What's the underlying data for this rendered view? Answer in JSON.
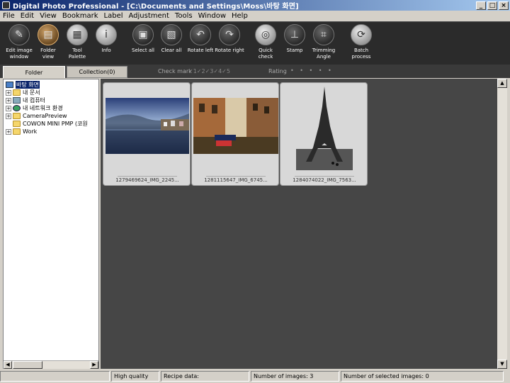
{
  "window": {
    "title": "Digital Photo Professional - [C:\\Documents and Settings\\Moss\\바탕 화면]",
    "minimize": "_",
    "maximize": "□",
    "close": "×"
  },
  "menu": [
    "File",
    "Edit",
    "View",
    "Bookmark",
    "Label",
    "Adjustment",
    "Tools",
    "Window",
    "Help"
  ],
  "toolbar": {
    "edit_image_window": "Edit image\nwindow",
    "folder_view": "Folder\nview",
    "tool_palette": "Tool\nPalette",
    "info": "Info",
    "select_all": "Select all",
    "clear_all": "Clear all",
    "rotate_left": "Rotate left",
    "rotate_right": "Rotate right",
    "quick_check": "Quick\ncheck",
    "stamp": "Stamp",
    "trimming_angle": "Trimming\nAngle",
    "batch_process": "Batch\nprocess"
  },
  "tabs": {
    "folder": "Folder",
    "collection": "Collection(0)"
  },
  "filters": {
    "check_mark_label": "Check mark",
    "check_marks": "✓1✓2✓3✓4✓5",
    "rating_label": "Rating",
    "rating_dots": "• • • • •"
  },
  "tree": {
    "desktop": "바탕 화면",
    "my_documents": "내 문서",
    "my_computer": "내 컴퓨터",
    "my_network": "내 네트워크 환경",
    "camera_preview": "CameraPreview",
    "cowon": "COWON MINI PMP (코원",
    "work": "Work"
  },
  "thumbnails": [
    {
      "caption": "1279469624_IMG_2245..."
    },
    {
      "caption": "1281115647_IMG_6745..."
    },
    {
      "caption": "1284074022_IMG_7563..."
    }
  ],
  "status": {
    "quality": "High quality",
    "recipe": "Recipe data:",
    "num_images": "Number of images: 3",
    "num_selected": "Number of selected images: 0"
  }
}
